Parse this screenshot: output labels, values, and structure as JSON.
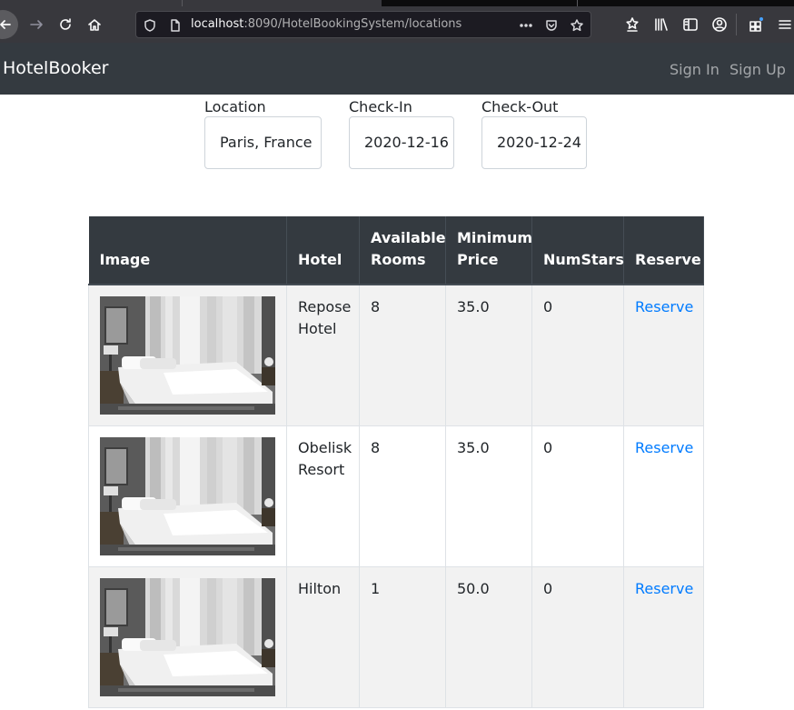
{
  "browser": {
    "url_host": "localhost",
    "url_rest": ":8090/HotelBookingSystem/locations"
  },
  "navbar": {
    "brand": "HotelBooker",
    "sign_in": "Sign In",
    "sign_up": "Sign Up"
  },
  "search": {
    "location_label": "Location",
    "location_value": "Paris, France",
    "checkin_label": "Check-In",
    "checkin_value": "2020-12-16",
    "checkout_label": "Check-Out",
    "checkout_value": "2020-12-24"
  },
  "table": {
    "headers": [
      "Image",
      "Hotel",
      "Available Rooms",
      "Minimum Price",
      "NumStars",
      "Reserve"
    ],
    "rows": [
      {
        "hotel": "Repose Hotel",
        "rooms": "8",
        "price": "35.0",
        "stars": "0",
        "reserve": "Reserve"
      },
      {
        "hotel": "Obelisk Resort",
        "rooms": "8",
        "price": "35.0",
        "stars": "0",
        "reserve": "Reserve"
      },
      {
        "hotel": "Hilton",
        "rooms": "1",
        "price": "50.0",
        "stars": "0",
        "reserve": "Reserve"
      }
    ]
  },
  "colors": {
    "navbar": "#343a40",
    "link": "#007bff",
    "row_stripe": "#f2f2f2"
  },
  "icons": [
    "back-icon",
    "forward-icon",
    "reload-icon",
    "home-icon",
    "shield-icon",
    "page-icon",
    "more-icon",
    "pocket-icon",
    "star-icon",
    "downloads-icon",
    "library-icon",
    "sidebar-icon",
    "account-icon",
    "extensions-icon",
    "menu-icon"
  ]
}
